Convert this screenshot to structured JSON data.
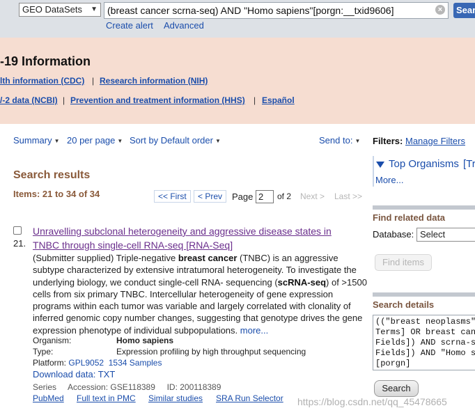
{
  "search_bar": {
    "database": "GEO DataSets",
    "query": "(breast cancer scrna-seq) AND \"Homo sapiens\"[porgn:__txid9606]",
    "search_label": "Search",
    "create_alert": "Create alert",
    "advanced": "Advanced"
  },
  "banner": {
    "title": "-19 Information",
    "links_row1": [
      "lth information (CDC)",
      "Research information (NIH)"
    ],
    "links_row2": [
      "/-2 data (NCBI)",
      "Prevention and treatment information (HHS)",
      "Español"
    ],
    "separator": "|"
  },
  "toolbar": {
    "summary": "Summary",
    "per_page": "20 per page",
    "sort": "Sort by Default order",
    "send_to": "Send to:"
  },
  "results": {
    "heading": "Search results",
    "items_range": "Items: 21 to 34 of 34",
    "pager": {
      "first": "<< First",
      "prev": "< Prev",
      "page_label": "Page",
      "page_value": "2",
      "of": "of 2",
      "next": "Next >",
      "last": "Last >>"
    }
  },
  "result": {
    "number": "21.",
    "title_line1": "Unravelling subclonal heterogeneity and aggressive disease states in",
    "title_line2": "TNBC through single-cell RNA-seq [RNA-Seq]",
    "desc": {
      "p1": "(Submitter supplied) Triple-negative ",
      "hl1": "breast cancer",
      "p2": " (TNBC) is an aggressive subtype characterized by extensive intratumoral heterogeneity. To investigate the underlying biology, we conduct single-cell RNA- sequencing (",
      "hl2": "scRNA-seq",
      "p3": ") of >1500 cells from six primary TNBC. Intercellular heterogeneity of gene expression programs within each tumor was variable and largely correlated with clonality of inferred genomic copy number changes, suggesting that genotype drives the gene expression phenotype of individual subpopulations.",
      "more": "more..."
    },
    "organism_label": "Organism:",
    "organism_value": "Homo sapiens",
    "type_label": "Type:",
    "type_value": "Expression profiling by high throughput sequencing",
    "platform_label": "Platform:",
    "platform_value": "GPL9052",
    "samples": "1534 Samples",
    "download": "Download data: TXT",
    "series": "Series",
    "accession": "Accession: GSE118389",
    "id": "ID: 200118389",
    "links": [
      "PubMed",
      "Full text in PMC",
      "Similar studies",
      "SRA Run Selector"
    ]
  },
  "sidebar": {
    "filters_label": "Filters:",
    "manage_filters": "Manage Filters",
    "top_organisms": "Top Organisms",
    "tree": "[Tr",
    "more": "More...",
    "find_related": "Find related data",
    "database_label": "Database:",
    "database_value": "Select",
    "find_items": "Find items",
    "search_details": "Search details",
    "details_text": "((\"breast neoplasms\"[\nTerms] OR breast canc\nFields]) AND scrna-se\nFields]) AND \"Homo sa\n[porgn]",
    "search_button": "Search"
  },
  "watermark": "https://blog.csdn.net/qq_45478665"
}
